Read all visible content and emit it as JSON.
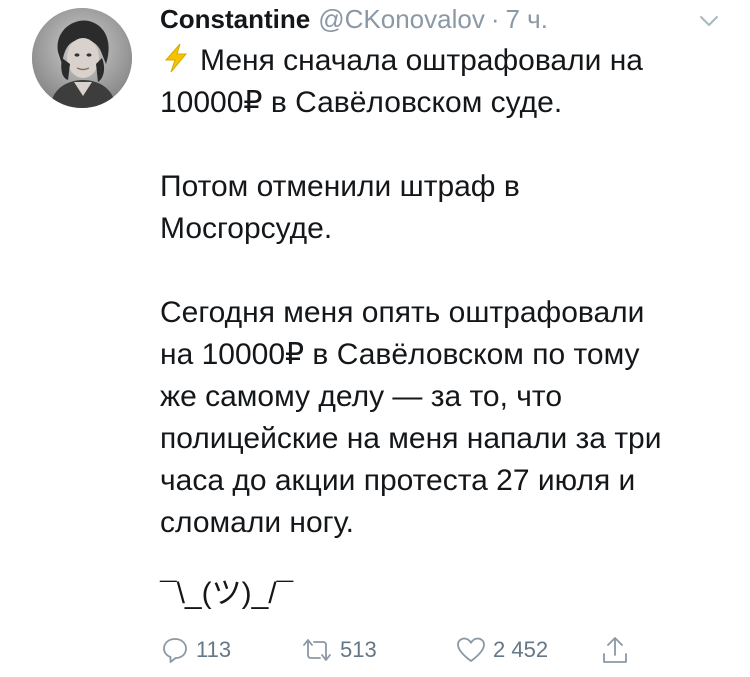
{
  "tweet": {
    "author": {
      "display_name": "Constantine",
      "handle": "@CKonovalov",
      "separator": "·",
      "time": "7 ч."
    },
    "paragraphs": [
      {
        "lines": [
          "Меня сначала оштрафовали на",
          "10000₽ в Савёловском суде."
        ]
      },
      {
        "lines": [
          "Потом отменили штраф в",
          "Мосгорсуде."
        ]
      },
      {
        "lines": [
          "Сегодня меня опять оштрафовали",
          "на 10000₽ в Савёловском по тому",
          "же самому делу — за то, что",
          "полицейские на меня напали за три",
          "часа до акции протеста 27 июля и",
          "сломали ногу."
        ]
      }
    ],
    "shrug": "¯\\_(ツ)_/¯",
    "stats": {
      "replies": "113",
      "retweets": "513",
      "likes": "2 452"
    },
    "icons": {
      "lead": "lightning-icon",
      "menu": "chevron-down-icon",
      "reply": "reply-icon",
      "retweet": "retweet-icon",
      "like": "heart-icon",
      "share": "share-icon"
    },
    "colors": {
      "text": "#14171a",
      "muted": "#8b98a5",
      "bolt": "#f5c400"
    }
  }
}
